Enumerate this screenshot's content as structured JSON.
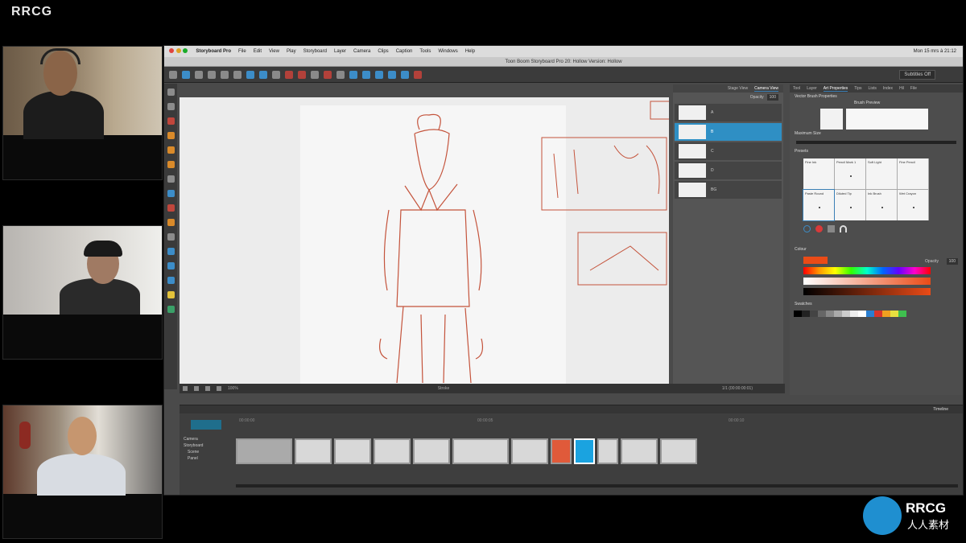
{
  "watermark": "RRCG",
  "brand_bottom": {
    "name": "RRCG",
    "sub": "人人素材"
  },
  "menubar": {
    "items": [
      "Storyboard Pro",
      "File",
      "Edit",
      "View",
      "Play",
      "Storyboard",
      "Layer",
      "Camera",
      "Clips",
      "Caption",
      "Tools",
      "Windows",
      "Help"
    ],
    "clock": "Mon 15 mrs à 21:12"
  },
  "window_title": "Toon Boom Storyboard Pro 20: Hollow Version: Hollow",
  "toolbar": {
    "subtitle_select": "Subtitles Off"
  },
  "layers_panel": {
    "tabs": [
      "Stage View",
      "Camera View"
    ],
    "opacity_label": "Opacity",
    "opacity_value": "100",
    "rows": [
      "A",
      "B",
      "C",
      "D",
      "BG"
    ]
  },
  "props_panel": {
    "tabs": [
      "Tool",
      "Layer",
      "Art Properties",
      "Tips",
      "Lists",
      "Index",
      "Hil",
      "File"
    ],
    "section_brush": "Vector Brush Properties",
    "brush_preview_label": "Brush Preview",
    "max_size_label": "Maximum Size",
    "presets_label": "Presets",
    "presets": [
      "Fine Ink",
      "Pencil Mark 1",
      "Soft Light",
      "Fine Pencil",
      "Paste Round",
      "Diluted Tip",
      "Ink Brush",
      "Wet Crayon"
    ],
    "colour_label": "Colour",
    "opacity_label": "Opacity",
    "opacity_value": "100",
    "swatches_label": "Swatches",
    "colour_hex": "#ea4b17"
  },
  "stage_footer": {
    "zoom": "100%",
    "view": "Stroke",
    "frame": "1/1 (00:00:00:01)"
  },
  "timeline": {
    "title": "Timeline",
    "tracks": [
      "Camera",
      "Storyboard",
      "Scene",
      "Panel"
    ],
    "ruler": [
      "00:00:00",
      "00:00:05",
      "00:00:10"
    ]
  }
}
